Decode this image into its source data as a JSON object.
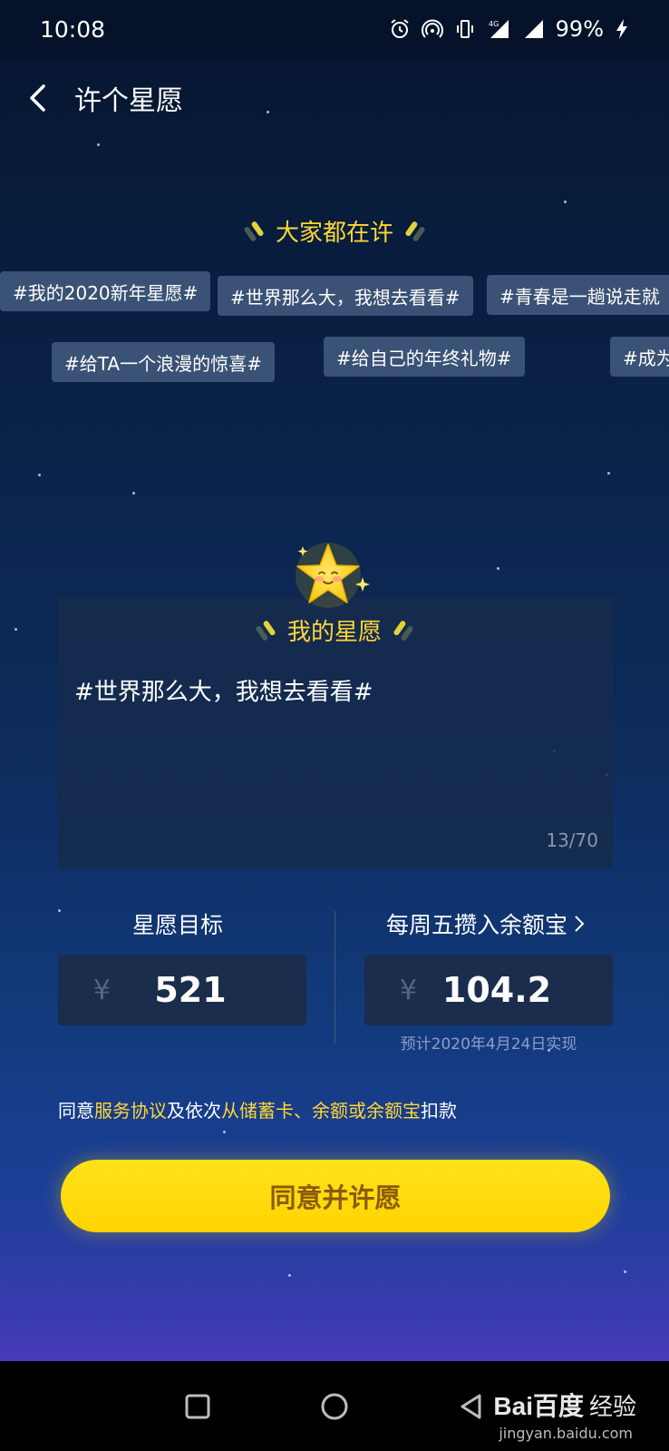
{
  "status_bar": {
    "time": "10:08",
    "battery": "99%",
    "network": "4G"
  },
  "header": {
    "title": "许个星愿"
  },
  "popular": {
    "title": "大家都在许",
    "tags": [
      "#我的2020新年星愿#",
      "#世界那么大，我想去看看#",
      "#青春是一趟说走就",
      "#给TA一个浪漫的惊喜#",
      "#给自己的年终礼物#",
      "#成为"
    ]
  },
  "wish_card": {
    "title": "我的星愿",
    "text": "#世界那么大，我想去看看#",
    "counter": "13/70"
  },
  "target": {
    "label": "星愿目标",
    "currency": "¥",
    "amount": "521"
  },
  "weekly": {
    "label": "每周五攒入余额宝",
    "currency": "¥",
    "amount": "104.2",
    "forecast": "预计2020年4月24日实现"
  },
  "agreement": {
    "p1": "同意",
    "link1": "服务协议",
    "p2": "及依次",
    "link2": "从储蓄卡、余额或余额宝",
    "p3": "扣款"
  },
  "cta": {
    "label": "同意并许愿"
  },
  "watermark": {
    "logo": "Bai百度",
    "text": "经验",
    "url": "jingyan.baidu.com"
  },
  "colors": {
    "accent": "#ffd736",
    "cta": "#ffd400",
    "tag_bg": "#3a5275"
  }
}
